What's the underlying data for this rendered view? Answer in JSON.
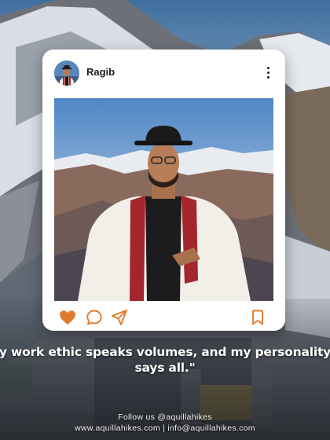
{
  "post": {
    "username": "Ragib",
    "avatar_icon": "profile-photo",
    "more_icon": "vertical-ellipsis-icon",
    "liked": true,
    "like_color": "#e07b2e",
    "actions": [
      "heart-icon",
      "comment-icon",
      "share-icon",
      "bookmark-icon"
    ]
  },
  "quote": {
    "text": "y work ethic speaks volumes, and my personality says all.\""
  },
  "footer": {
    "follow": "Follow us @aquillahikes",
    "contact": "www.aquillahikes.com | info@aquillahikes.com"
  },
  "colors": {
    "accent": "#e07b2e",
    "card": "#ffffff"
  }
}
